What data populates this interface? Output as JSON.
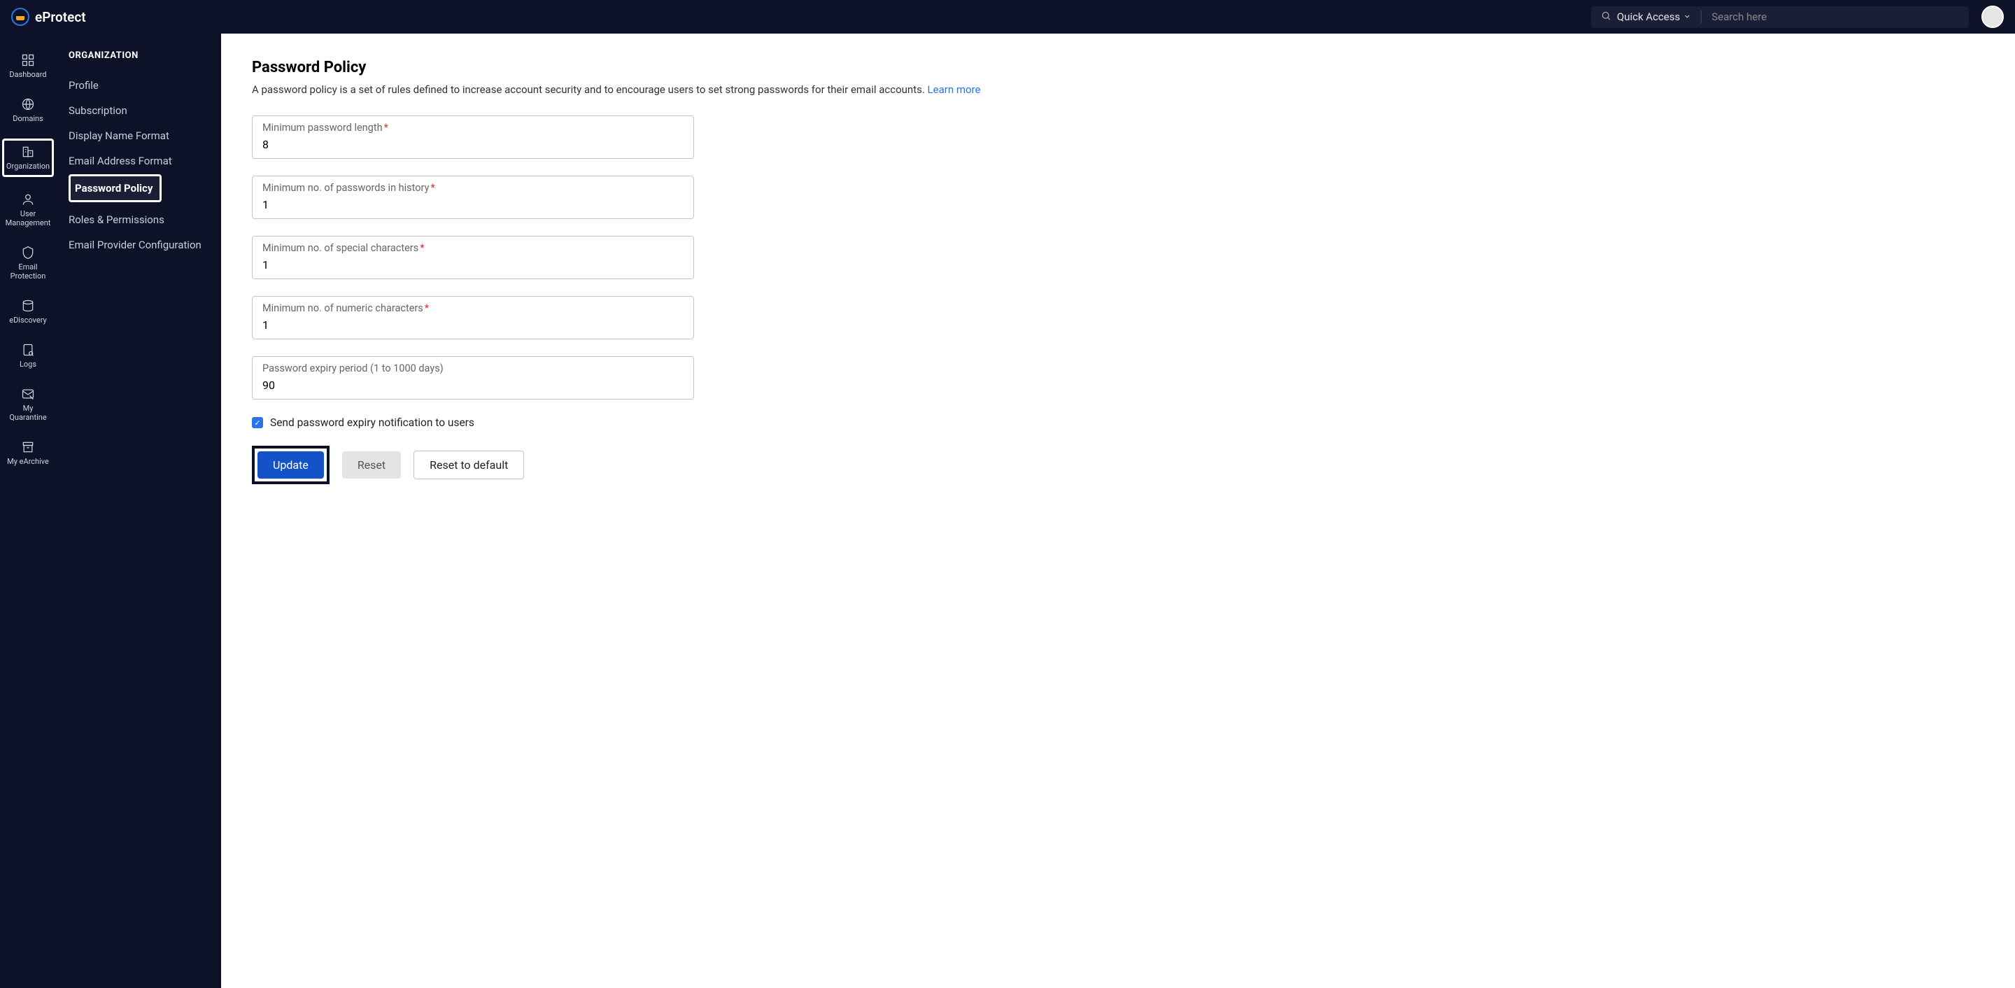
{
  "brand": {
    "name": "eProtect"
  },
  "header": {
    "quick_access": "Quick Access",
    "search_placeholder": "Search here"
  },
  "icon_nav": [
    {
      "id": "dashboard",
      "label": "Dashboard"
    },
    {
      "id": "domains",
      "label": "Domains"
    },
    {
      "id": "organization",
      "label": "Organization",
      "highlighted": true
    },
    {
      "id": "user-mgmt",
      "label": "User Management"
    },
    {
      "id": "email-protection",
      "label": "Email Protection"
    },
    {
      "id": "ediscovery",
      "label": "eDiscovery"
    },
    {
      "id": "logs",
      "label": "Logs"
    },
    {
      "id": "my-quarantine",
      "label": "My Quarantine"
    },
    {
      "id": "my-earchive",
      "label": "My eArchive"
    }
  ],
  "secondary_nav": {
    "header": "ORGANIZATION",
    "items": [
      {
        "label": "Profile"
      },
      {
        "label": "Subscription"
      },
      {
        "label": "Display Name Format"
      },
      {
        "label": "Email Address Format"
      },
      {
        "label": "Password Policy",
        "active": true,
        "highlighted": true
      },
      {
        "label": "Roles & Permissions"
      },
      {
        "label": "Email Provider Configuration"
      }
    ]
  },
  "page": {
    "title": "Password Policy",
    "description": "A password policy is a set of rules defined to increase account security and to encourage users to set strong passwords for their email accounts.",
    "learn_more": "Learn more"
  },
  "form": {
    "min_length": {
      "label": "Minimum password length",
      "value": "8",
      "required": true
    },
    "history": {
      "label": "Minimum no. of passwords in history",
      "value": "1",
      "required": true
    },
    "special": {
      "label": "Minimum no. of special characters",
      "value": "1",
      "required": true
    },
    "numeric": {
      "label": "Minimum no. of numeric characters",
      "value": "1",
      "required": true
    },
    "expiry": {
      "label": "Password expiry period (1 to 1000 days)",
      "value": "90",
      "required": false
    },
    "notify": {
      "label": "Send password expiry notification to users",
      "checked": true
    }
  },
  "buttons": {
    "update": "Update",
    "reset": "Reset",
    "reset_default": "Reset to default"
  }
}
